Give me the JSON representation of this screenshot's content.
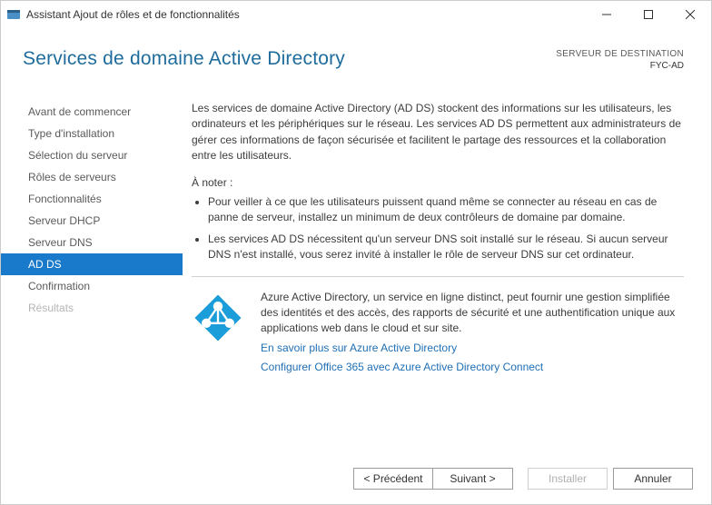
{
  "window": {
    "title": "Assistant Ajout de rôles et de fonctionnalités"
  },
  "header": {
    "page_title": "Services de domaine Active Directory",
    "destination_label": "SERVEUR DE DESTINATION",
    "destination_value": "FYC-AD"
  },
  "sidebar": {
    "items": [
      {
        "label": "Avant de commencer",
        "state": "normal"
      },
      {
        "label": "Type d'installation",
        "state": "normal"
      },
      {
        "label": "Sélection du serveur",
        "state": "normal"
      },
      {
        "label": "Rôles de serveurs",
        "state": "normal"
      },
      {
        "label": "Fonctionnalités",
        "state": "normal"
      },
      {
        "label": "Serveur DHCP",
        "state": "normal"
      },
      {
        "label": "Serveur DNS",
        "state": "normal"
      },
      {
        "label": "AD DS",
        "state": "active"
      },
      {
        "label": "Confirmation",
        "state": "normal"
      },
      {
        "label": "Résultats",
        "state": "disabled"
      }
    ]
  },
  "content": {
    "intro": "Les services de domaine Active Directory (AD DS) stockent des informations sur les utilisateurs, les ordinateurs et les périphériques sur le réseau. Les services AD DS permettent aux administrateurs de gérer ces informations de façon sécurisée et facilitent le partage des ressources et la collaboration entre les utilisateurs.",
    "note_title": "À noter :",
    "notes": [
      "Pour veiller à ce que les utilisateurs puissent quand même se connecter au réseau en cas de panne de serveur, installez un minimum de deux contrôleurs de domaine par domaine.",
      "Les services AD DS nécessitent qu'un serveur DNS soit installé sur le réseau. Si aucun serveur DNS n'est installé, vous serez invité à installer le rôle de serveur DNS sur cet ordinateur."
    ],
    "azure": {
      "desc": "Azure Active Directory, un service en ligne distinct, peut fournir une gestion simplifiée des identités et des accès, des rapports de sécurité et une authentification unique aux applications web dans le cloud et sur site.",
      "link1": "En savoir plus sur Azure Active Directory",
      "link2": "Configurer Office 365 avec Azure Active Directory Connect"
    }
  },
  "footer": {
    "previous": "< Précédent",
    "next": "Suivant >",
    "install": "Installer",
    "cancel": "Annuler"
  }
}
